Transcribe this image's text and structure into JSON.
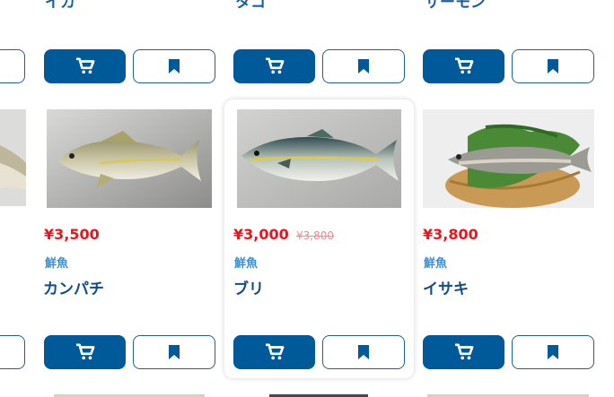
{
  "top_row": {
    "names": [
      "イカ",
      "タコ",
      "サーモン"
    ]
  },
  "products": [
    {
      "price": "¥3,500",
      "old_price": "",
      "category": "鮮魚",
      "name": "カンパチ",
      "image_icon": "kanpachi-fish-image"
    },
    {
      "price": "¥3,000",
      "old_price": "¥3,800",
      "category": "鮮魚",
      "name": "ブリ",
      "image_icon": "buri-fish-image"
    },
    {
      "price": "¥3,800",
      "old_price": "",
      "category": "鮮魚",
      "name": "イサキ",
      "image_icon": "isaki-fish-image"
    }
  ],
  "icons": {
    "cart": "cart-icon",
    "bookmark": "bookmark-icon"
  },
  "colors": {
    "primary": "#005999",
    "price": "#e8141e",
    "old_price": "#ef8a8f",
    "category": "#3f8fd0",
    "name": "#134c7e"
  }
}
